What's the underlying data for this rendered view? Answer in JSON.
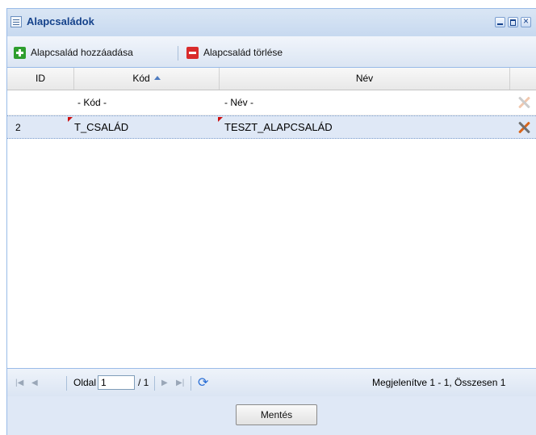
{
  "window": {
    "title": "Alapcsaládok"
  },
  "toolbar": {
    "add_label": "Alapcsalád hozzáadása",
    "delete_label": "Alapcsalád törlése"
  },
  "grid": {
    "columns": [
      "ID",
      "Kód",
      "Név"
    ],
    "sort": {
      "column": "Kód",
      "direction": "ascending"
    },
    "filter": {
      "kod_placeholder": "- Kód -",
      "nev_placeholder": "- Név -"
    },
    "rows": [
      {
        "id": "2",
        "kod": "T_CSALÁD",
        "nev": "TESZT_ALAPCSALÁD",
        "selected": true
      }
    ]
  },
  "pager": {
    "page_label": "Oldal",
    "page_value": "1",
    "page_of": "/ 1",
    "display": "Megjelenítve 1 - 1, Összesen 1"
  },
  "footer": {
    "save_label": "Mentés"
  },
  "colors": {
    "panel_bg": "#dfe8f6",
    "title_text": "#15428b",
    "border": "#99bbe8",
    "selected_row": "#dfe8f6"
  }
}
